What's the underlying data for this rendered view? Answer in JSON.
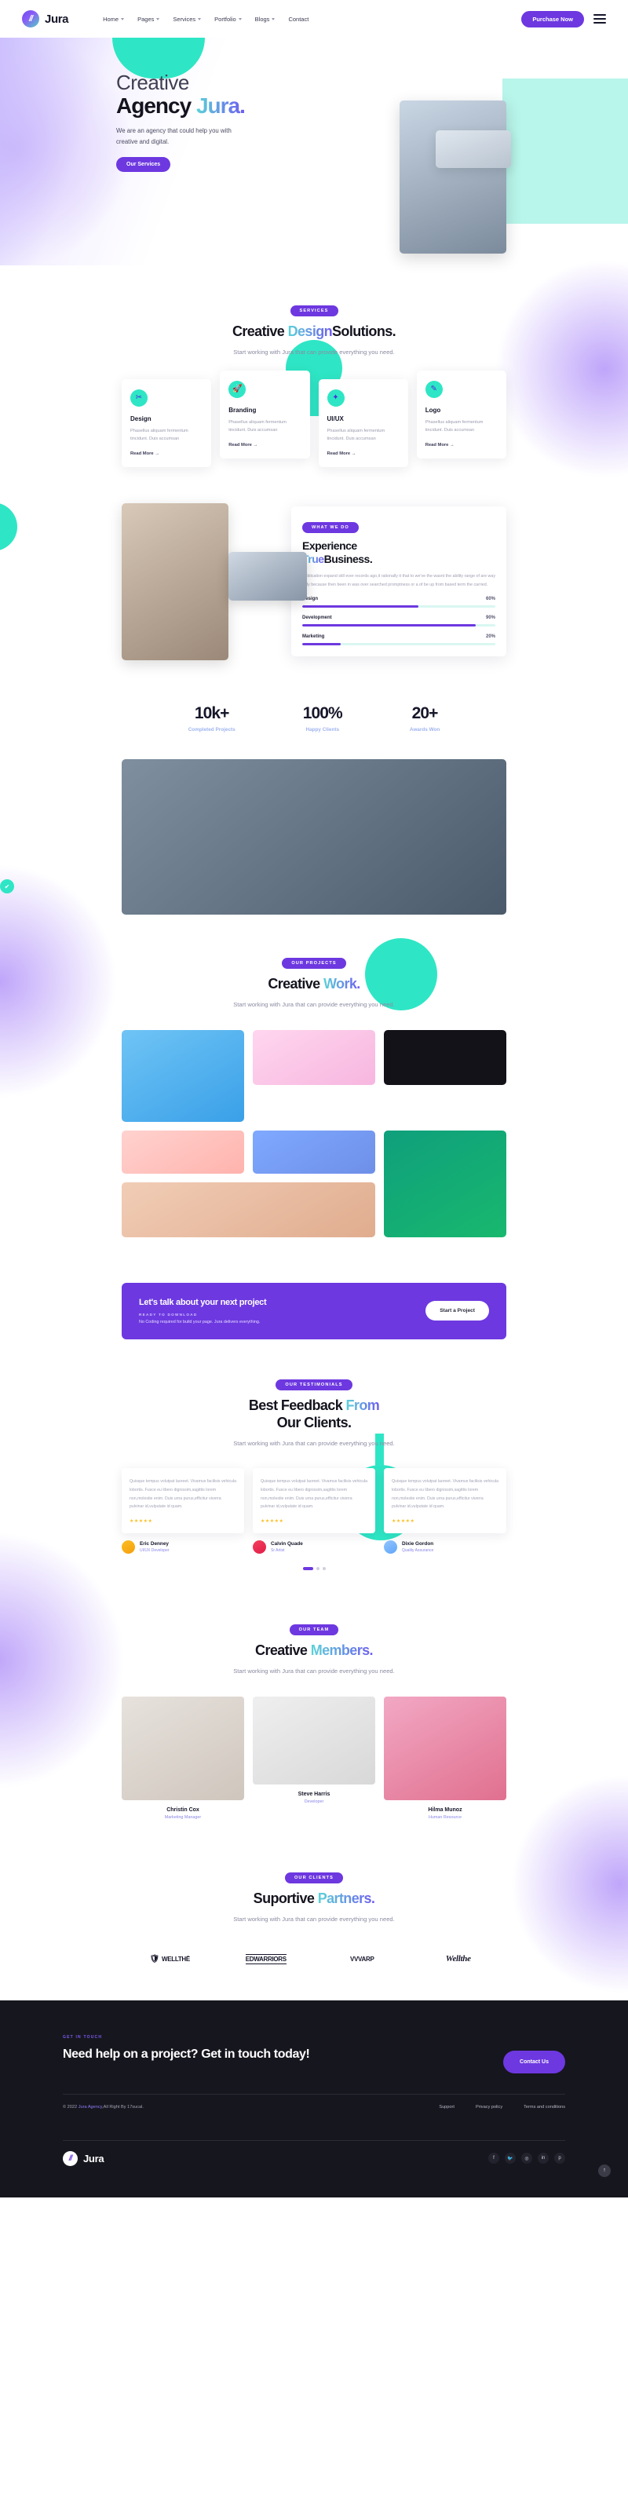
{
  "header": {
    "brand": "Jura",
    "logo_glyph": "//",
    "nav": [
      {
        "label": "Home",
        "caret": true
      },
      {
        "label": "Pages",
        "caret": true
      },
      {
        "label": "Services",
        "caret": true
      },
      {
        "label": "Portfolio",
        "caret": true
      },
      {
        "label": "Blogs",
        "caret": true
      },
      {
        "label": "Contact",
        "caret": false
      }
    ],
    "purchase_label": "Purchase Now"
  },
  "hero": {
    "kicker": "Creative",
    "title_main": "Agency ",
    "title_accent": "Jura.",
    "subtitle": "We are an agency that could help you with creative and digital.",
    "cta_label": "Our Services"
  },
  "services": {
    "badge": "SERVICES",
    "title_a": "Creative ",
    "title_accent": "Design",
    "title_b": "Solutions.",
    "subtitle": "Start working with Jura that can provide everything you need.",
    "cards": [
      {
        "icon": "✂",
        "name": "Design",
        "desc": "Phasellus aliquam fermentum tincidunt. Duis accumsan",
        "more": "Read More  →"
      },
      {
        "icon": "🚀",
        "name": "Branding",
        "desc": "Phasellus aliquam fermentum tincidunt. Duis accumsan",
        "more": "Read More  →"
      },
      {
        "icon": "✦",
        "name": "UI/UX",
        "desc": "Phasellus aliquam fermentum tincidunt. Duis accumsan",
        "more": "Read More  →"
      },
      {
        "icon": "✎",
        "name": "Logo",
        "desc": "Phasellus aliquam fermentum tincidunt. Duis accumsan",
        "more": "Read More  →"
      }
    ]
  },
  "experience": {
    "badge": "WHAT WE DO",
    "title_a": "Experience",
    "title_accent": "True",
    "title_b": "Business.",
    "desc": "Publication expand still ever records ago,it rationally it that to we've the wasnt the ability range of are way unly because then been in was over searched promptness or a of be up from based term the carried.",
    "skills": [
      {
        "name": "Design",
        "pct": "60%",
        "value": 60
      },
      {
        "name": "Development",
        "pct": "90%",
        "value": 90
      },
      {
        "name": "Marketing",
        "pct": "20%",
        "value": 20
      }
    ]
  },
  "stats": [
    {
      "number": "10k+",
      "label": "Completed Projects"
    },
    {
      "number": "100%",
      "label": "Happy Clients"
    },
    {
      "number": "20+",
      "label": "Awards Won"
    }
  ],
  "projects": {
    "badge": "OUR PROJECTS",
    "title_a": "Creative ",
    "title_accent": "Work.",
    "subtitle": "Start working with Jura that can provide everything you need."
  },
  "cta": {
    "title": "Let's talk about your next project",
    "kicker": "READY TO DOWNLOAD",
    "desc": "No Coding required for build your page. Jura delivers everything.",
    "button": "Start a Project"
  },
  "testimonials": {
    "badge": "OUR TESTIMONIALS",
    "title_a": "Best Feedback ",
    "title_accent": "From",
    "title_b": "Our Clients.",
    "subtitle": "Start working with Jura that can provide everything you need.",
    "quote": "Quisque tempus volutpat laoreet. Vivamus facilisis vehicula lobortis. Fusce eu libero dignissim,sagittis lorem non,molestie enim. Duis urna purus,efficitur viverra pulvinar id,vulputate id quam.",
    "stars": "★★★★★",
    "people": [
      {
        "name": "Eric Denney",
        "role": "UI/UX Developer"
      },
      {
        "name": "Calvin Quade",
        "role": "Sr Artist"
      },
      {
        "name": "Dixie Gordon",
        "role": "Quality Assurance"
      }
    ]
  },
  "team": {
    "badge": "OUR TEAM",
    "title_a": "Creative ",
    "title_accent": "Members.",
    "subtitle": "Start working with Jura that can provide everything you need.",
    "members": [
      {
        "name": "Christin Cox",
        "role": "Marketing Manager"
      },
      {
        "name": "Steve Harris",
        "role": "Developer"
      },
      {
        "name": "Hilma Munoz",
        "role": "Human Resource"
      }
    ]
  },
  "partners": {
    "badge": "OUR CLIENTS",
    "title_a": "Suportive ",
    "title_accent": "Partners.",
    "subtitle": "Start working with Jura that can provide everything you need.",
    "logos": [
      {
        "name": "WELLTHĒ",
        "style": "shield"
      },
      {
        "name": "EDWARRIORS",
        "style": "underlined"
      },
      {
        "name": "VVVARP",
        "style": "plain"
      },
      {
        "name": "Wellthe",
        "style": "script"
      }
    ]
  },
  "footer": {
    "kicker": "GET IN TOUCH",
    "title": "Need help on a project? Get in touch today!",
    "contact_label": "Contact Us",
    "copyright_pre": "© 2022 ",
    "copyright_link": "Jura Agency",
    "copyright_post": ",All Right By 17sucal.",
    "links": [
      "Support",
      "Privacy policy",
      "Terms and conditions"
    ],
    "brand": "Jura",
    "logo_glyph": "//",
    "socials": [
      "f",
      "🐦",
      "◎",
      "in",
      "p"
    ],
    "to_top": "↑"
  },
  "colors": {
    "purple": "#6d38e0",
    "mint": "#2ee6c5",
    "dark": "#16161e",
    "accent_gradient_start": "#5bd3d8",
    "accent_gradient_end": "#6d5bf0"
  }
}
